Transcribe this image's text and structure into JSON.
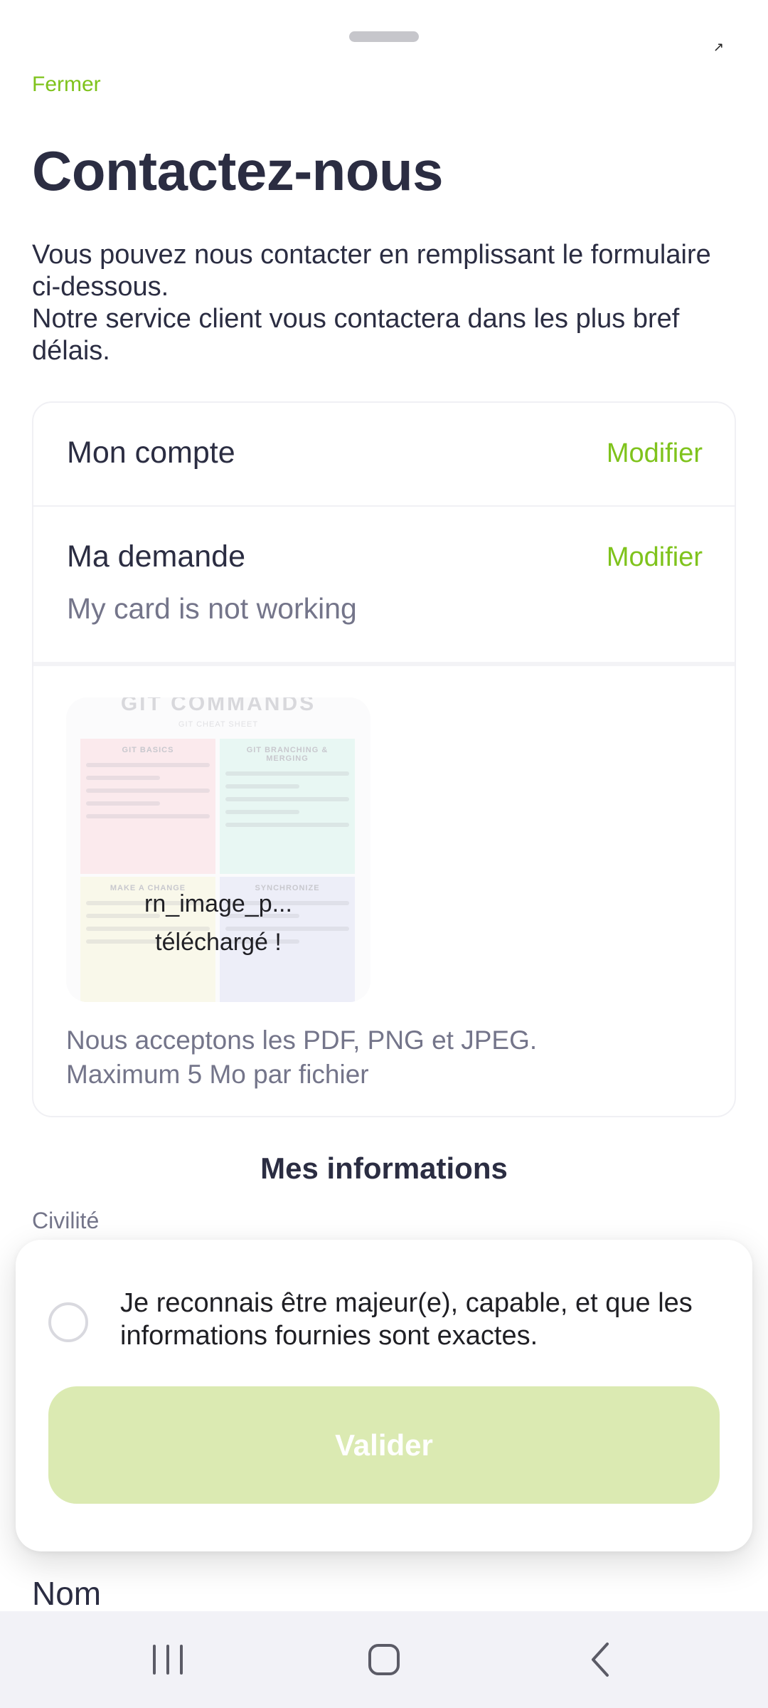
{
  "header": {
    "close_label": "Fermer",
    "title": "Contactez-nous",
    "intro_line1": "Vous pouvez nous contacter en remplissant le formulaire ci-dessous.",
    "intro_line2": "Notre service client vous contactera dans les plus bref délais."
  },
  "account_row": {
    "label": "Mon compte",
    "action": "Modifier"
  },
  "request_row": {
    "label": "Ma demande",
    "action": "Modifier",
    "value": "My card is not working"
  },
  "attachment": {
    "thumb_title": "GIT COMMANDS",
    "thumb_subtitle": "GIT CHEAT SHEET",
    "quadrants": [
      "GIT BASICS",
      "GIT BRANCHING & MERGING",
      "MAKE A CHANGE",
      "SYNCHRONIZE"
    ],
    "filename": "rn_image_p...",
    "status": "téléchargé !",
    "accepted_formats": "Nous acceptons les PDF, PNG et JPEG.",
    "max_size": "Maximum 5 Mo par fichier"
  },
  "info_section": {
    "title": "Mes informations",
    "civility_label": "Civilité",
    "name_label": "Nom"
  },
  "consent_modal": {
    "checkbox_label": "Je reconnais être majeur(e), capable, et que les informations fournies sont exactes.",
    "submit_label": "Valider",
    "accent_color": "#7fc31c",
    "disabled_button_color": "#dbeab2"
  },
  "navbar": {
    "icons": [
      "recent-apps-icon",
      "home-icon",
      "back-icon"
    ]
  }
}
